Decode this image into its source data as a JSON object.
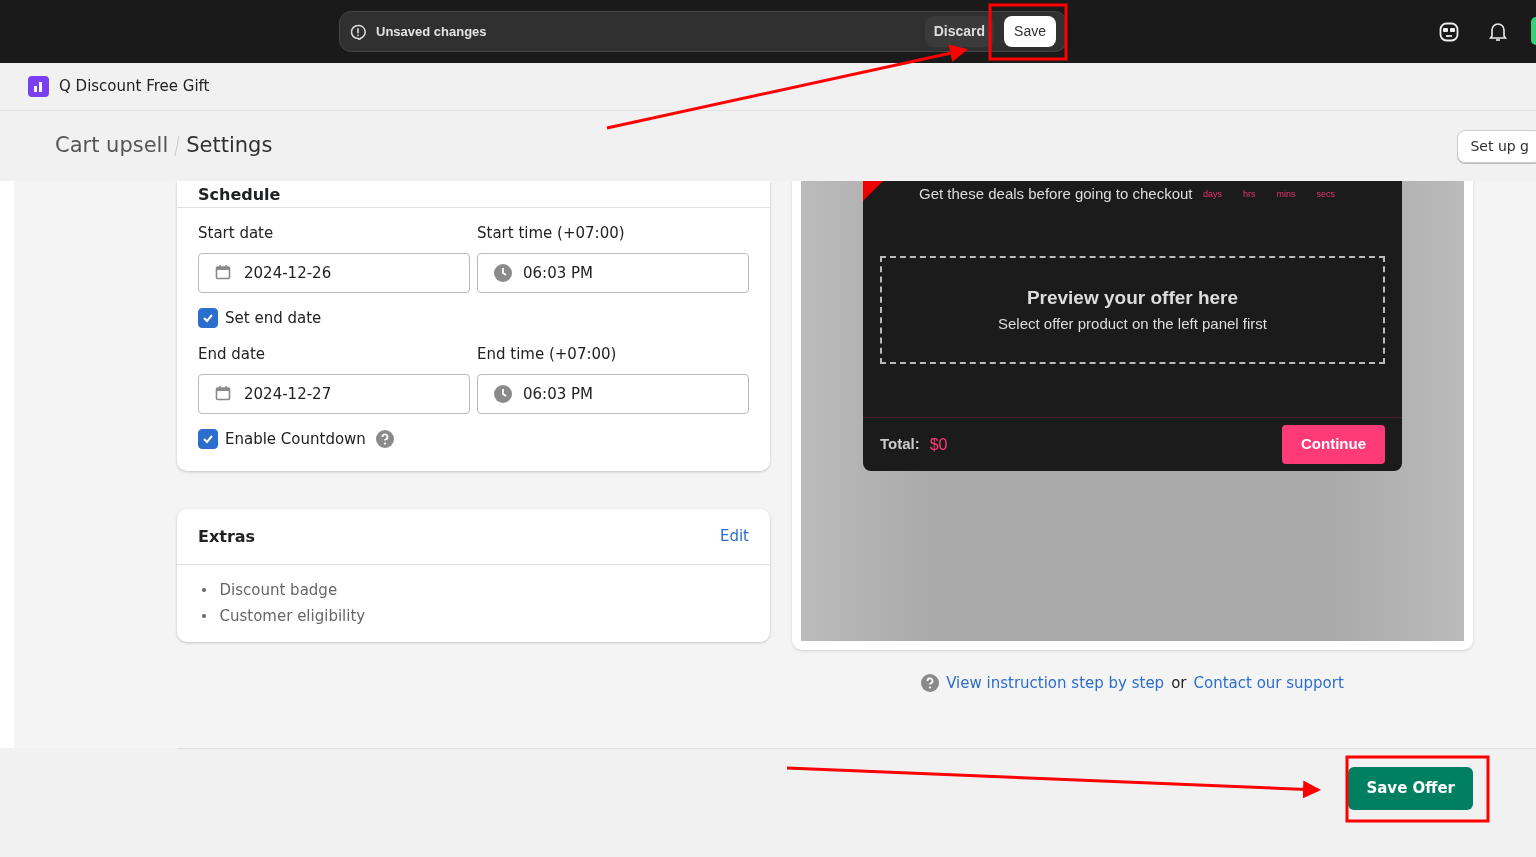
{
  "topbar": {
    "status": "Unsaved changes",
    "discard": "Discard",
    "save": "Save"
  },
  "app": {
    "name": "Q Discount Free Gift"
  },
  "header": {
    "breadcrumb": [
      "Cart upsell",
      "Settings"
    ],
    "action": "Set up g"
  },
  "schedule": {
    "title": "Schedule",
    "start": [
      {
        "kind": "date",
        "label": "Start date",
        "value": "2024-12-26"
      },
      {
        "kind": "time",
        "label": "Start time (+07:00)",
        "value": "06:03 PM"
      }
    ],
    "set_end": {
      "label": "Set end date",
      "checked": true
    },
    "end": [
      {
        "kind": "date",
        "label": "End date",
        "value": "2024-12-27"
      },
      {
        "kind": "time",
        "label": "End time (+07:00)",
        "value": "06:03 PM"
      }
    ],
    "countdown": {
      "label": "Enable Countdown",
      "checked": true
    }
  },
  "extras": {
    "title": "Extras",
    "edit": "Edit",
    "items": [
      "Discount badge",
      "Customer eligibility"
    ]
  },
  "preview": {
    "headline": "Get these deals before going to checkout",
    "units": [
      "days",
      "hrs",
      "mins",
      "secs"
    ],
    "placeholder_title": "Preview your offer here",
    "placeholder_text": "Select offer product on the left panel first",
    "total_label": "Total:",
    "total_value": "$0",
    "continue": "Continue"
  },
  "help": {
    "link1": "View instruction step by step",
    "joiner": "or",
    "link2": "Contact our support"
  },
  "footer": {
    "save": "Save Offer"
  }
}
